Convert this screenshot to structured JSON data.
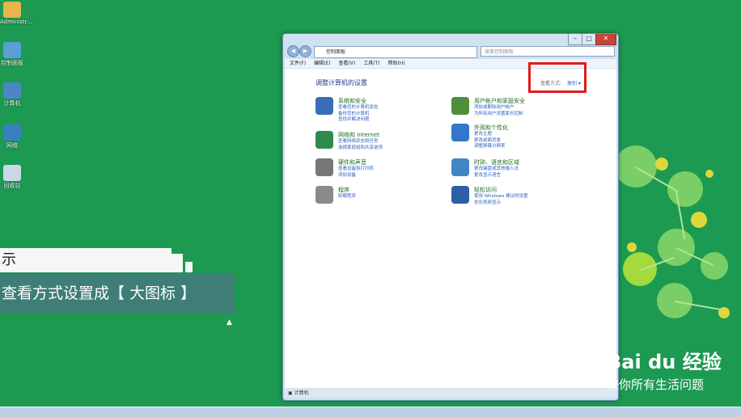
{
  "desktop": {
    "icons": [
      {
        "label": "Administr...",
        "color": "#e6b64a"
      },
      {
        "label": "控制面板",
        "color": "#5aa0d6"
      },
      {
        "label": "计算机",
        "color": "#4a86c8"
      },
      {
        "label": "网络",
        "color": "#3a7ec0"
      },
      {
        "label": "回收站",
        "color": "#c9d8e6"
      }
    ]
  },
  "captions": {
    "top": "示",
    "bottom": "查看方式设置成【 大图标 】"
  },
  "window": {
    "address_crumb": "控制面板",
    "search_placeholder": "搜索控制面板",
    "menu": [
      "文件(F)",
      "编辑(E)",
      "查看(V)",
      "工具(T)",
      "帮助(H)"
    ],
    "heading": "调整计算机的设置",
    "view_by_label": "查看方式:",
    "view_by_value": "类别 ▾",
    "categories": [
      {
        "title": "系统和安全",
        "links": [
          "查看您的计算机状态",
          "备份您的计算机",
          "查找并解决问题"
        ],
        "color": "#3a6cb8"
      },
      {
        "title": "网络和 Internet",
        "links": [
          "查看网络状态和任务",
          "选择家庭组和共享选项"
        ],
        "color": "#2f8a4e"
      },
      {
        "title": "硬件和声音",
        "links": [
          "查看设备和打印机",
          "添加设备"
        ],
        "color": "#777777"
      },
      {
        "title": "程序",
        "links": [
          "卸载程序"
        ],
        "color": "#8a8a8a"
      },
      {
        "title": "用户帐户和家庭安全",
        "links": [
          "添加或删除用户帐户",
          "为所有用户设置家长控制"
        ],
        "color": "#4f8f3a"
      },
      {
        "title": "外观和个性化",
        "links": [
          "更改主题",
          "更改桌面背景",
          "调整屏幕分辨率"
        ],
        "color": "#3477c9"
      },
      {
        "title": "时钟、语言和区域",
        "links": [
          "更改键盘或其他输入法",
          "更改显示语言"
        ],
        "color": "#3f86c2"
      },
      {
        "title": "轻松访问",
        "links": [
          "使用 Windows 建议的设置",
          "优化视频显示"
        ],
        "color": "#2d5fa8"
      }
    ],
    "status": "计算机"
  },
  "watermark": {
    "logo": "Bai du 经验",
    "tagline": "决你所有生活问题"
  }
}
